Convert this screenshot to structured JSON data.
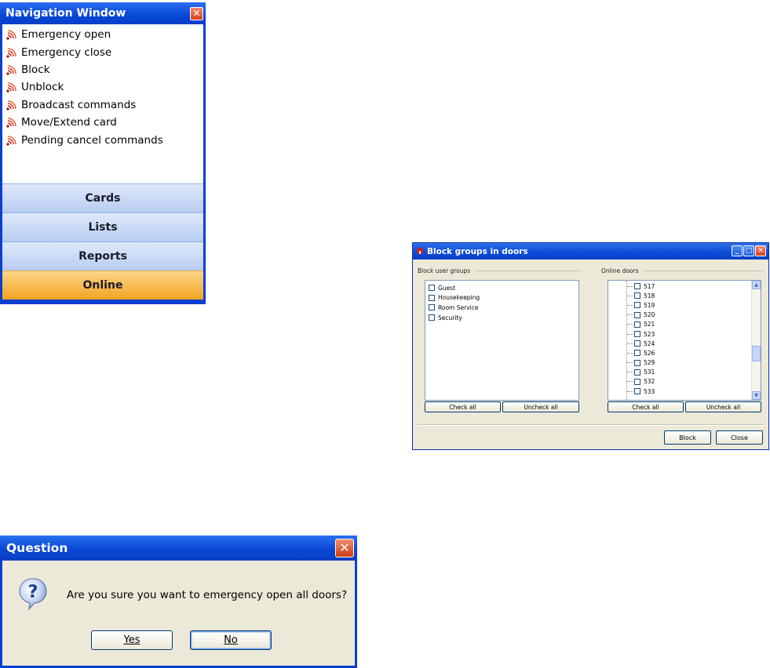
{
  "nav_window": {
    "title": "Navigation Window",
    "items": [
      {
        "label": "Emergency open",
        "icon": "signal-waves-icon"
      },
      {
        "label": "Emergency close",
        "icon": "signal-waves-icon"
      },
      {
        "label": "Block",
        "icon": "signal-waves-icon"
      },
      {
        "label": "Unblock",
        "icon": "signal-waves-icon"
      },
      {
        "label": "Broadcast commands",
        "icon": "signal-waves-icon"
      },
      {
        "label": "Move/Extend card",
        "icon": "signal-waves-icon"
      },
      {
        "label": "Pending cancel commands",
        "icon": "signal-waves-icon"
      }
    ],
    "groups": [
      "Cards",
      "Lists",
      "Reports",
      "Online"
    ],
    "active_group": "Online"
  },
  "block_dialog": {
    "title": "Block groups in doors",
    "user_groups_label": "Block user groups",
    "online_doors_label": "Online doors",
    "user_groups": [
      "Guest",
      "Housekeeping",
      "Room Service",
      "Security"
    ],
    "doors": [
      "517",
      "518",
      "519",
      "520",
      "521",
      "523",
      "524",
      "526",
      "529",
      "531",
      "532",
      "533"
    ],
    "check_all": "Check all",
    "uncheck_all": "Uncheck all",
    "block_button": "Block",
    "close_button": "Close"
  },
  "question_dialog": {
    "title": "Question",
    "message": "Are you sure you want to emergency open all doors?",
    "yes": "Yes",
    "no": "No"
  },
  "colors": {
    "xp_title_blue": "#0a3fd0",
    "dialog_face": "#ece9d8",
    "online_orange": "#f3a321",
    "group_blue": "#b7ccf1",
    "icon_red": "#c8201a"
  }
}
